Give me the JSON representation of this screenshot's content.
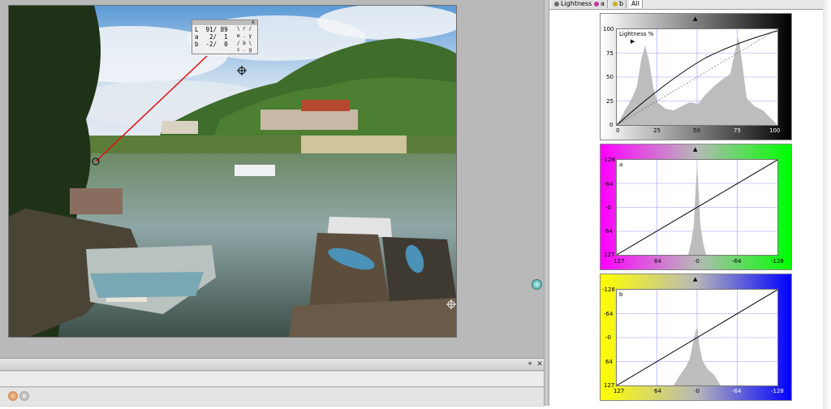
{
  "tabs": [
    {
      "label": "Lightness",
      "color": "#6a6a6a"
    },
    {
      "label": "a",
      "color": "#c4349c"
    },
    {
      "label": "b",
      "color": "#c7b32a"
    },
    {
      "label": "All",
      "color": null
    }
  ],
  "readout": {
    "lines": [
      "L  91/ 89",
      "a   2/  1",
      "b  -2/  0"
    ],
    "symbols": [
      "\\ r /",
      "m . y",
      "/ b \\",
      "c . g"
    ]
  },
  "graphs": {
    "lightness": {
      "channel": "Lightness %",
      "y_ticks": [
        "100",
        "75",
        "50",
        "25",
        "0"
      ],
      "x_ticks": [
        "0",
        "25",
        "50",
        "75",
        "100"
      ],
      "gradient": [
        "#ffffff",
        "#000000"
      ]
    },
    "a": {
      "channel": "a",
      "y_ticks": [
        "-128",
        "-64",
        "-0",
        "64",
        "127"
      ],
      "x_ticks": [
        "127",
        "64",
        "-0",
        "-64",
        "-128"
      ],
      "gradient": [
        "#ff00ff",
        "#00ff00"
      ]
    },
    "b": {
      "channel": "b",
      "y_ticks": [
        "-128",
        "-64",
        "-0",
        "64",
        "127"
      ],
      "x_ticks": [
        "127",
        "64",
        "-0",
        "-64",
        "-128"
      ],
      "gradient": [
        "#ffff00",
        "#0000ff"
      ]
    }
  },
  "icons": {
    "pin": "pin-icon",
    "close": "close-icon",
    "sync": "sync-icon",
    "sampler": "color-sampler-icon"
  },
  "panel_controls": {
    "pin": "⌖",
    "close": "✕"
  }
}
